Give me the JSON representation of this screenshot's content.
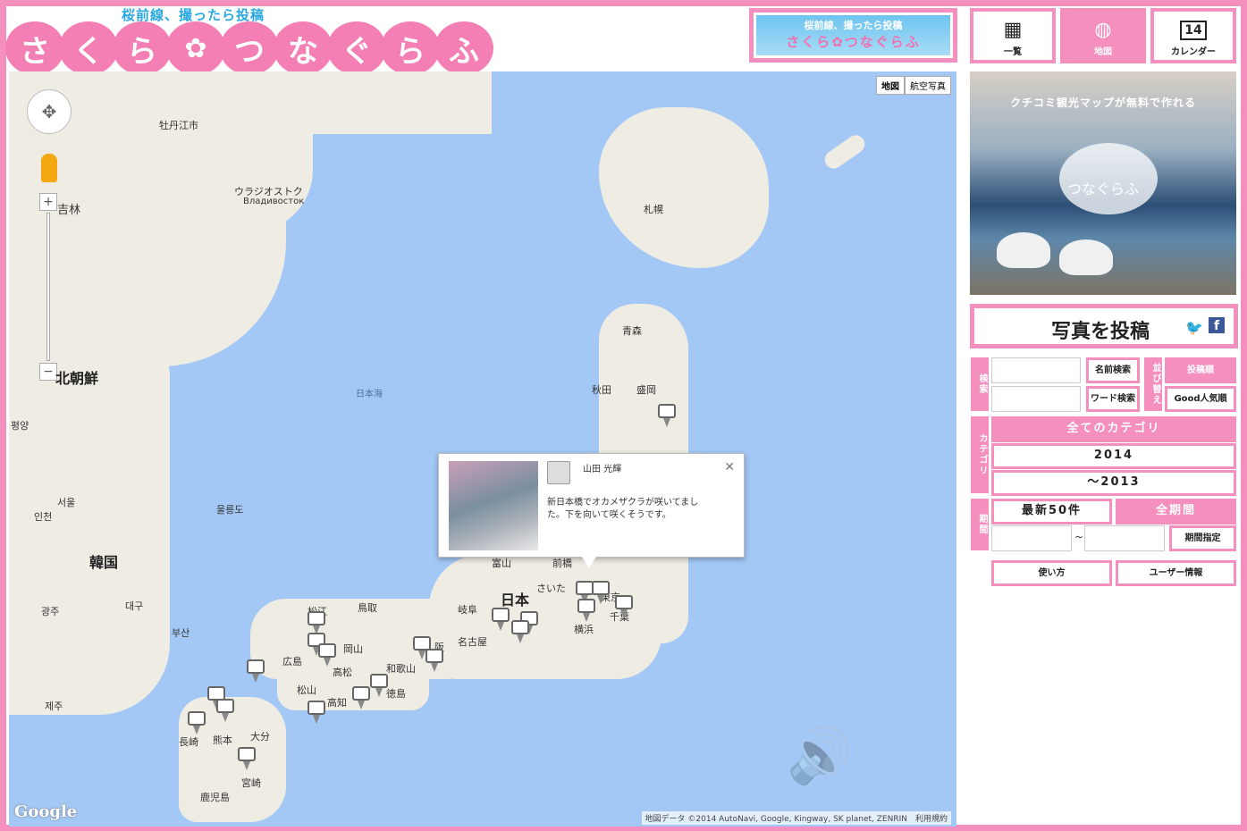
{
  "header": {
    "logo_sub": "桜前線、撮ったら投稿",
    "logo_chars": [
      "さ",
      "く",
      "ら",
      "✿",
      "つ",
      "な",
      "ぐ",
      "ら",
      "ふ"
    ],
    "banner_sub": "桜前線、撮ったら投稿",
    "banner_main": "さくら✿つなぐらふ"
  },
  "nav": {
    "list_label": "一覧",
    "map_label": "地図",
    "calendar_label": "カレンダー",
    "calendar_day": "14"
  },
  "map": {
    "type_map": "地図",
    "type_satellite": "航空写真",
    "sea_label": "日本海",
    "country_japan": "日本",
    "country_korea": "韓国",
    "country_nk": "北朝鮮",
    "places": {
      "sapporo": "札幌",
      "aomori": "青森",
      "akita": "秋田",
      "morioka": "盛岡",
      "toyama": "富山",
      "maebashi": "前橋",
      "saitama": "さいた",
      "tokyo": "東京",
      "chiba": "千葉",
      "yokohama": "横浜",
      "gifu": "岐阜",
      "nagoya": "名古屋",
      "osaka": "阪",
      "wakayama": "和歌山",
      "tottori": "鳥取",
      "matsue": "松江",
      "okayama": "岡山",
      "hiroshima": "広島",
      "takamatsu": "高松",
      "matsuyama": "松山",
      "kochi": "高知",
      "tokushima": "徳島",
      "nagasaki": "長崎",
      "kumamoto": "熊本",
      "oita": "大分",
      "miyazaki": "宮崎",
      "kagoshima": "鹿児島",
      "seoul": "서울",
      "incheon": "인천",
      "busan": "부산",
      "daegu": "대구",
      "gwangju": "광주",
      "jeju": "제주",
      "ulleung": "울릉도",
      "vladivostok": "ウラジオストク",
      "vladivostok_ru": "Владивосток",
      "pyongyang": "평양",
      "jilin": "吉林",
      "mudanjiang": "牡丹江市"
    },
    "google": "Google",
    "copyright": "地図データ ©2014 AutoNavi, Google, Kingway, SK planet, ZENRIN　利用規約"
  },
  "popup": {
    "username": "山田 光輝",
    "text": "新日本橋でオカメザクラが咲いてました。下を向いて咲くそうです。",
    "close": "✕"
  },
  "promo": {
    "headline": "クチコミ観光マップが無料で作れる",
    "logo": "つなぐらふ"
  },
  "post": {
    "label": "写真を投稿",
    "twitter": "🐦",
    "facebook": "f"
  },
  "search": {
    "section_label": "検索",
    "name_search": "名前検索",
    "word_search": "ワード検索",
    "name_value": "",
    "word_value": ""
  },
  "sort": {
    "section_label": "並び替え",
    "by_post": "投稿順",
    "by_good": "Good人気順"
  },
  "category": {
    "section_label": "カテゴリ",
    "all": "全てのカテゴリ",
    "year_2014": "2014",
    "year_2013": "～2013"
  },
  "period": {
    "section_label": "期間",
    "latest50": "最新50件",
    "all": "全期間",
    "from_value": "",
    "to_value": "",
    "tilde": "~",
    "specify": "期間指定"
  },
  "footer": {
    "howto": "使い方",
    "userinfo": "ユーザー情報"
  },
  "colors": {
    "brand_pink": "#f48fbe",
    "logo_blue": "#2aa7df",
    "water": "#a4c8f5",
    "land": "#efece4"
  }
}
